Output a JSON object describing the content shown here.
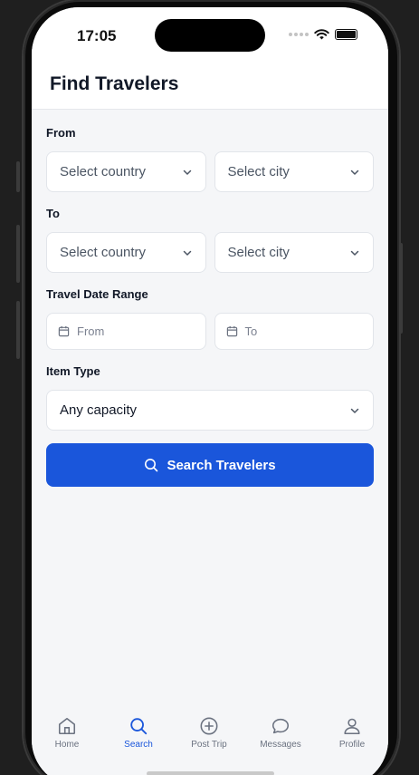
{
  "status_bar": {
    "time": "17:05"
  },
  "header": {
    "title": "Find Travelers"
  },
  "form": {
    "from": {
      "label": "From",
      "country_placeholder": "Select country",
      "city_placeholder": "Select city"
    },
    "to": {
      "label": "To",
      "country_placeholder": "Select country",
      "city_placeholder": "Select city"
    },
    "date_range": {
      "label": "Travel Date Range",
      "from_placeholder": "From",
      "to_placeholder": "To"
    },
    "item_type": {
      "label": "Item Type",
      "value": "Any capacity"
    },
    "search_button": {
      "label": "Search Travelers"
    }
  },
  "bottom_nav": {
    "items": [
      {
        "label": "Home",
        "icon": "home-icon"
      },
      {
        "label": "Search",
        "icon": "search-icon",
        "active": true
      },
      {
        "label": "Post Trip",
        "icon": "plus-circle-icon"
      },
      {
        "label": "Messages",
        "icon": "message-circle-icon"
      },
      {
        "label": "Profile",
        "icon": "user-icon"
      }
    ]
  },
  "colors": {
    "primary": "#1a56db",
    "background": "#f5f6f8",
    "text": "#111827"
  }
}
